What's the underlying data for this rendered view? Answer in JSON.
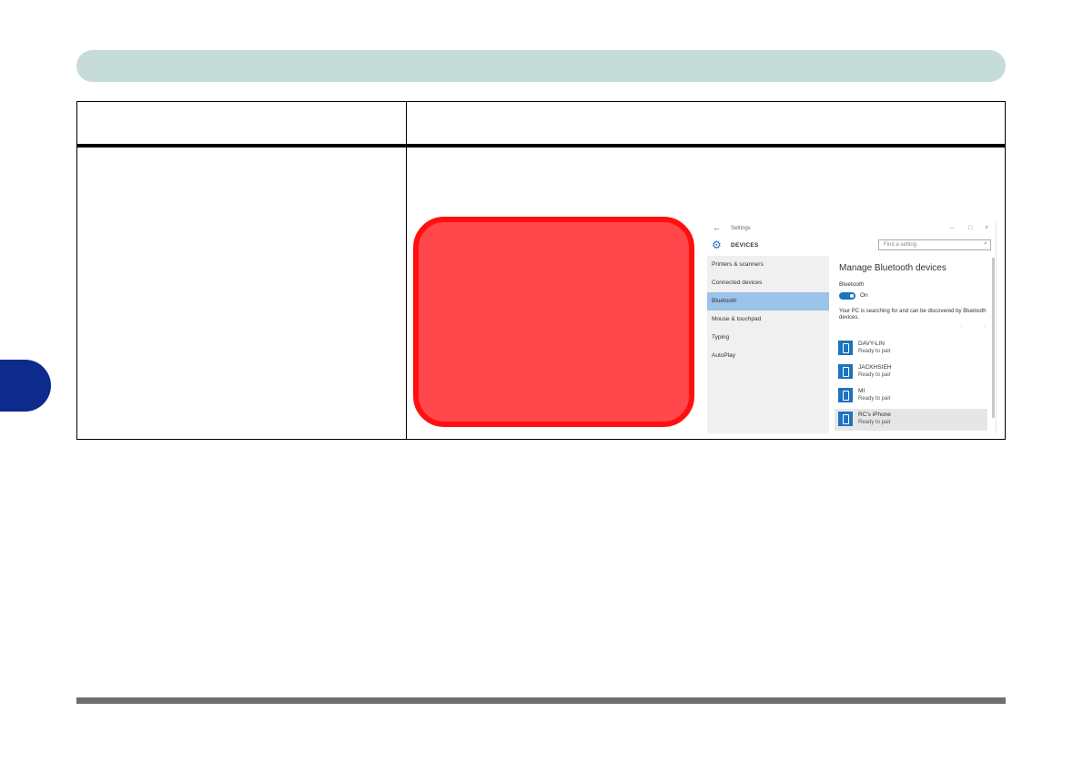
{
  "settings_window": {
    "title": "Settings",
    "controls": [
      "–",
      "□",
      "×"
    ],
    "back_icon": "back-arrow-icon",
    "section": "DEVICES",
    "search_placeholder": "Find a setting",
    "nav_items": [
      "Printers & scanners",
      "Connected devices",
      "Bluetooth",
      "Mouse & touchpad",
      "Typing",
      "AutoPlay"
    ],
    "selected_nav": "Bluetooth",
    "content_title": "Manage Bluetooth devices",
    "bluetooth_label": "Bluetooth",
    "toggle_state": "On",
    "description": "Your PC is searching for and can be discovered by Bluetooth devices.",
    "devices": [
      {
        "name": "DAVY-LIN",
        "status": "Ready to pair"
      },
      {
        "name": "JACKHSIEH",
        "status": "Ready to pair"
      },
      {
        "name": "MI",
        "status": "Ready to pair"
      },
      {
        "name": "RC's iPhone",
        "status": "Ready to pair"
      }
    ],
    "accent_color": "#1e73be"
  },
  "colors": {
    "header_bar": "#c5dcd8",
    "side_tab": "#0d2a8c",
    "callout_fill": "#ff474c",
    "callout_border": "#ff1010"
  }
}
